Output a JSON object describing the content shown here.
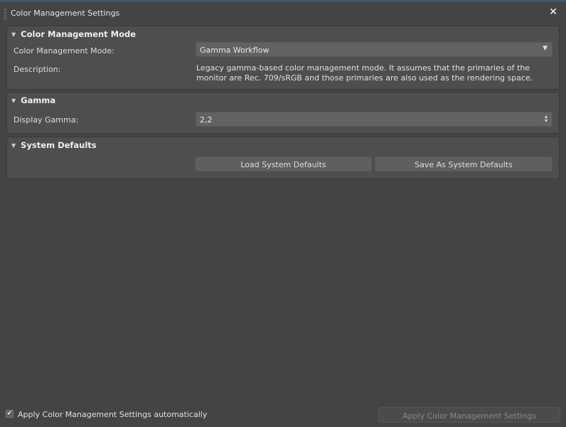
{
  "window": {
    "title": "Color Management Settings",
    "close_icon": "close-icon"
  },
  "mode_section": {
    "header": "Color Management Mode",
    "mode_label": "Color Management Mode:",
    "mode_value": "Gamma Workflow",
    "description_label": "Description:",
    "description": "Legacy gamma-based color management mode. It assumes that the primaries of the monitor are Rec. 709/sRGB and those primaries are also used as the rendering space."
  },
  "gamma_section": {
    "header": "Gamma",
    "display_gamma_label": "Display Gamma:",
    "display_gamma_value": "2,2"
  },
  "defaults_section": {
    "header": "System Defaults",
    "load_button": "Load System Defaults",
    "save_button": "Save As System Defaults"
  },
  "footer": {
    "auto_apply_label": "Apply Color Management Settings automatically",
    "auto_apply_checked": true,
    "apply_button": "Apply Color Management Settings"
  }
}
